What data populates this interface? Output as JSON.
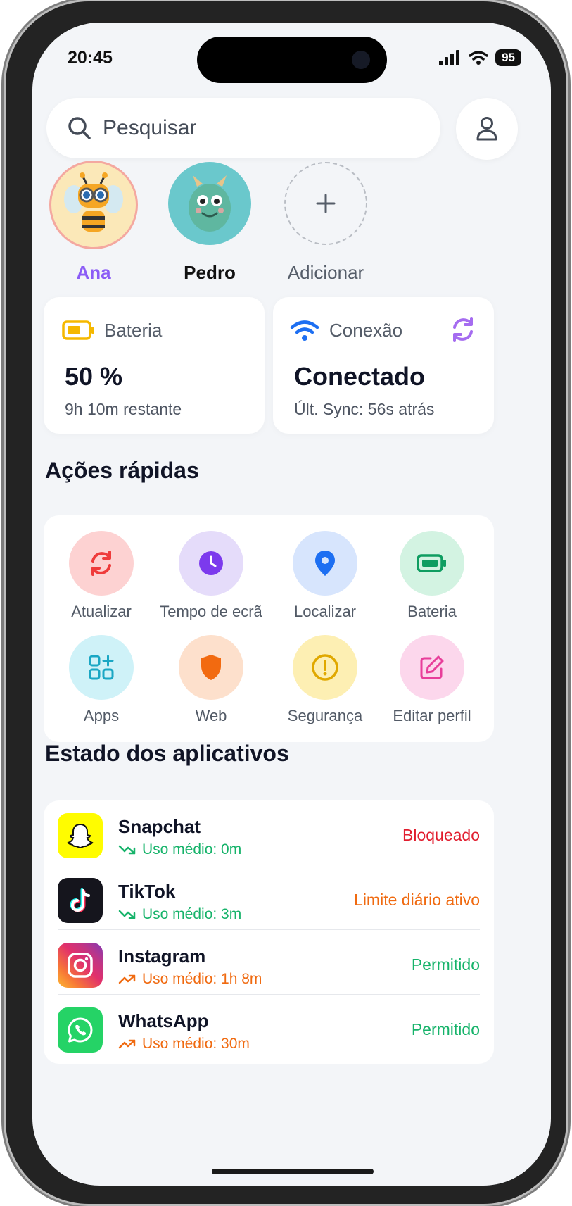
{
  "status_bar": {
    "time": "20:45",
    "battery": "95"
  },
  "search": {
    "placeholder": "Pesquisar"
  },
  "children": [
    {
      "name": "Ana",
      "color": "#8b5cf6"
    },
    {
      "name": "Pedro",
      "color": "#111111"
    },
    {
      "name": "Adicionar",
      "color": "#555d69"
    }
  ],
  "battery_card": {
    "label": "Bateria",
    "value": "50 %",
    "sub": "9h 10m restante"
  },
  "connection_card": {
    "label": "Conexão",
    "value": "Conectado",
    "sub": "Últ. Sync: 56s atrás"
  },
  "quick_actions": {
    "title": "Ações rápidas",
    "items": [
      {
        "label": "Atualizar",
        "icon": "refresh-icon"
      },
      {
        "label": "Tempo de ecrã",
        "icon": "clock-icon"
      },
      {
        "label": "Localizar",
        "icon": "location-pin-icon"
      },
      {
        "label": "Bateria",
        "icon": "battery-icon"
      },
      {
        "label": "Apps",
        "icon": "apps-grid-icon"
      },
      {
        "label": "Web",
        "icon": "shield-icon"
      },
      {
        "label": "Segurança",
        "icon": "alert-icon"
      },
      {
        "label": "Editar perfil",
        "icon": "edit-icon"
      }
    ]
  },
  "apps_state": {
    "title": "Estado dos aplicativos",
    "items": [
      {
        "name": "Snapchat",
        "usage": "Uso médio: 0m",
        "trend": "down",
        "status": "Bloqueado",
        "status_color": "#e11d2e"
      },
      {
        "name": "TikTok",
        "usage": "Uso médio: 3m",
        "trend": "down",
        "status": "Limite diário ativo",
        "status_color": "#f06a10"
      },
      {
        "name": "Instagram",
        "usage": "Uso médio: 1h 8m",
        "trend": "up",
        "status": "Permitido",
        "status_color": "#16b36a"
      },
      {
        "name": "WhatsApp",
        "usage": "Uso médio: 30m",
        "trend": "up",
        "status": "Permitido",
        "status_color": "#16b36a"
      }
    ]
  },
  "colors": {
    "accent": "#8b5cf6",
    "trend_down": "#16b36a",
    "trend_up": "#f06a10"
  }
}
